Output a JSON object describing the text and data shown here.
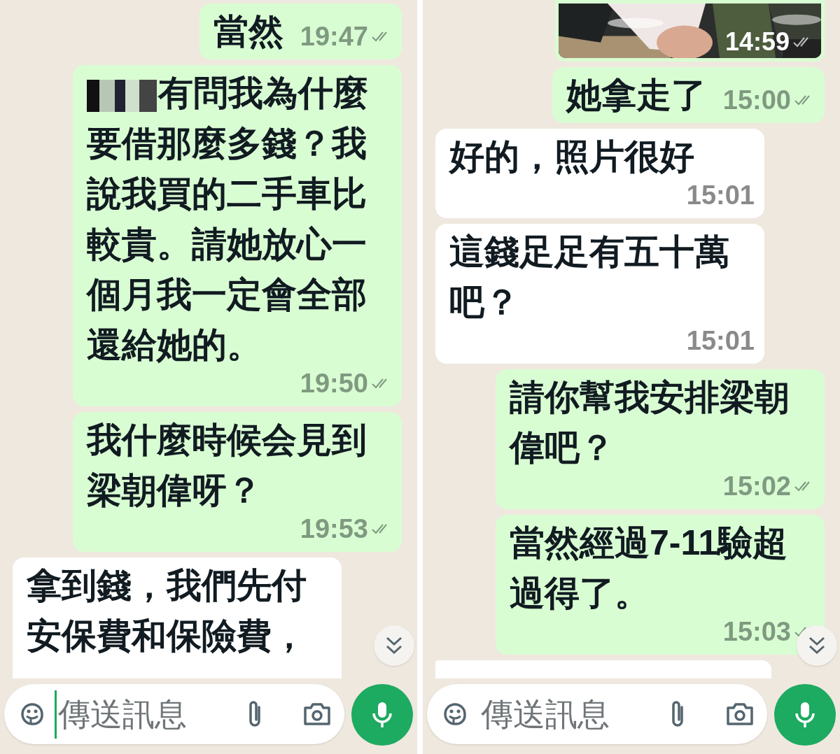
{
  "panels": [
    {
      "messages": [
        {
          "kind": "text",
          "outgoing": true,
          "text": "當然",
          "time": "19:47",
          "redacted_prefix": false
        },
        {
          "kind": "text",
          "outgoing": true,
          "text": "有問我為什麼要借那麼多錢？我說我買的二手車比較貴。請她放心一個月我一定會全部還給她的。",
          "time": "19:50",
          "redacted_prefix": true
        },
        {
          "kind": "text",
          "outgoing": true,
          "text": "我什麼時候会見到梁朝偉呀？",
          "time": "19:53",
          "redacted_prefix": false
        },
        {
          "kind": "text",
          "outgoing": false,
          "text": "拿到錢，我們先付安保費和保險費，",
          "cut": true
        }
      ],
      "composer": {
        "placeholder": "傳送訊息",
        "focused": true
      }
    },
    {
      "messages": [
        {
          "outgoing": true,
          "time": "14:59"
        },
        {
          "kind": "text",
          "outgoing": true,
          "text": "她拿走了",
          "time": "15:00",
          "redacted_prefix": false
        },
        {
          "kind": "text",
          "outgoing": false,
          "text": "好的，照片很好",
          "time": "15:01"
        },
        {
          "kind": "text",
          "outgoing": false,
          "text": "這錢足足有五十萬吧？",
          "time": "15:01"
        },
        {
          "kind": "text",
          "outgoing": true,
          "text": "請你幫我安排梁朝偉吧？",
          "time": "15:02",
          "redacted_prefix": false
        },
        {
          "kind": "text",
          "outgoing": true,
          "text": "當然經過7-11驗超過得了。",
          "time": "15:03",
          "redacted_prefix": false
        },
        {
          "kind": "partial",
          "outgoing": false
        }
      ],
      "composer": {
        "placeholder": "傳送訊息",
        "focused": false
      }
    }
  ]
}
